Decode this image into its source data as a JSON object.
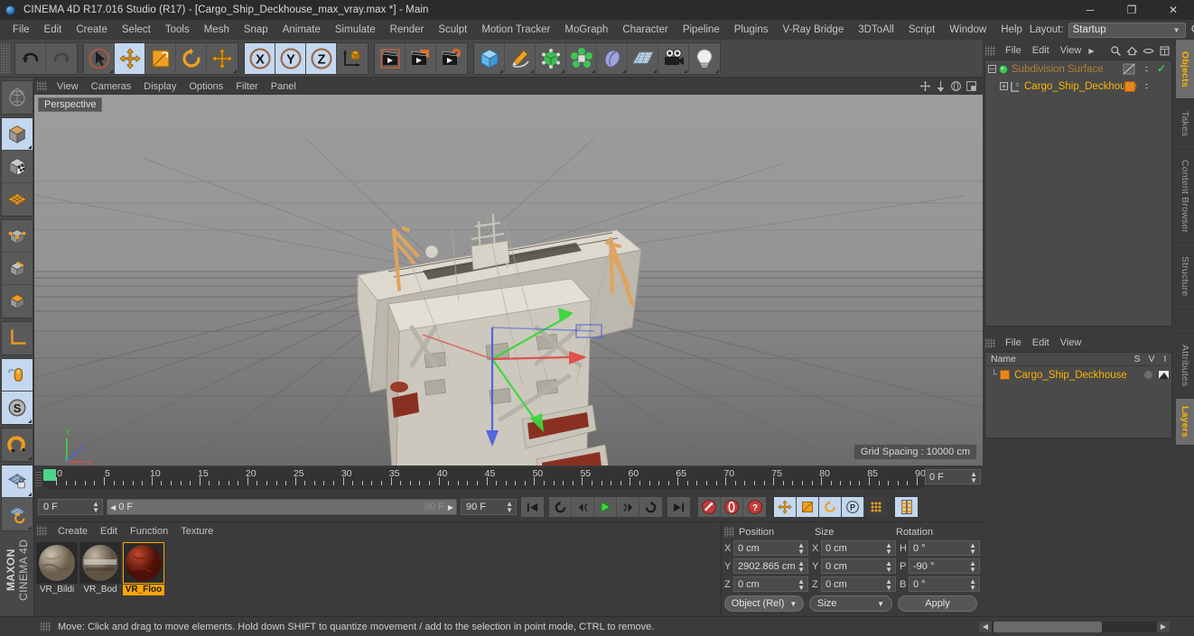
{
  "titlebar": {
    "title": "CINEMA 4D R17.016 Studio (R17) - [Cargo_Ship_Deckhouse_max_vray.max *] - Main",
    "minimize": "─",
    "maximize": "❐",
    "close": "✕"
  },
  "menubar": {
    "items": [
      "File",
      "Edit",
      "Create",
      "Select",
      "Tools",
      "Mesh",
      "Snap",
      "Animate",
      "Simulate",
      "Render",
      "Sculpt",
      "Motion Tracker",
      "MoGraph",
      "Character",
      "Pipeline",
      "Plugins",
      "V-Ray Bridge",
      "3DToAll",
      "Script",
      "Window",
      "Help"
    ],
    "layout_label": "Layout:",
    "layout_value": "Startup",
    "caret": "▼"
  },
  "toolbar": {
    "groups": [
      {
        "name": "undo-redo",
        "buttons": [
          {
            "icon": "undo-icon",
            "label": "Undo",
            "selected": false
          },
          {
            "icon": "redo-icon",
            "label": "Redo",
            "selected": false
          }
        ]
      },
      {
        "name": "transform-tools",
        "buttons": [
          {
            "icon": "live-selection-icon",
            "label": "Live Selection",
            "selected": false
          },
          {
            "icon": "move-icon",
            "label": "Move",
            "selected": true
          },
          {
            "icon": "scale-icon",
            "label": "Scale",
            "selected": false
          },
          {
            "icon": "rotate-icon",
            "label": "Rotate",
            "selected": false
          },
          {
            "icon": "move-alt-icon",
            "label": "Move (alt)",
            "selected": false
          }
        ]
      },
      {
        "name": "axis-locks",
        "buttons": [
          {
            "icon": "axis-x-icon",
            "label": "X",
            "selected": true
          },
          {
            "icon": "axis-y-icon",
            "label": "Y",
            "selected": true
          },
          {
            "icon": "axis-z-icon",
            "label": "Z",
            "selected": true
          },
          {
            "icon": "world-object-axis-icon",
            "label": "World / Object",
            "selected": false
          }
        ]
      },
      {
        "name": "render-tools",
        "buttons": [
          {
            "icon": "render-view-icon",
            "label": "Render View",
            "selected": false
          },
          {
            "icon": "render-picture-viewer-icon",
            "label": "Render to Picture Viewer",
            "selected": false
          },
          {
            "icon": "render-settings-icon",
            "label": "Edit Render Settings",
            "selected": false
          }
        ]
      },
      {
        "name": "object-tools",
        "buttons": [
          {
            "icon": "cube-primitive-icon",
            "label": "Add Cube Object",
            "selected": false
          },
          {
            "icon": "spline-pen-icon",
            "label": "Spline Pen",
            "selected": false
          },
          {
            "icon": "nurbs-icon",
            "label": "NURBS",
            "selected": false
          },
          {
            "icon": "array-modeling-icon",
            "label": "Modeling Objects",
            "selected": false
          },
          {
            "icon": "deformer-icon",
            "label": "Deformers",
            "selected": false
          },
          {
            "icon": "floor-environment-icon",
            "label": "Scene / Floor",
            "selected": false
          },
          {
            "icon": "camera-icon",
            "label": "Camera",
            "selected": false
          },
          {
            "icon": "light-icon",
            "label": "Light",
            "selected": false
          }
        ]
      }
    ]
  },
  "lefttoolbar": {
    "buttons": [
      {
        "icon": "make-editable-icon",
        "label": "Make Editable",
        "selected": false
      },
      {
        "icon": "model-mode-icon",
        "label": "Model Mode",
        "selected": true
      },
      {
        "icon": "texture-mode-icon",
        "label": "Texture Mode",
        "selected": false
      },
      {
        "icon": "polygon-mode-icon",
        "label": "Polygon Mode",
        "selected": false
      },
      {
        "icon": "point-mode-icon",
        "label": "Point Mode",
        "selected": false
      },
      {
        "icon": "edge-mode-icon",
        "label": "Edge Mode",
        "selected": false
      },
      {
        "icon": "object-axis-icon",
        "label": "Enable Axis",
        "selected": false
      },
      {
        "icon": "world-axis-icon",
        "label": "World Coordinates",
        "selected": false
      },
      {
        "icon": "viewport-solo-icon",
        "label": "Viewport Solo Single",
        "selected": true
      },
      {
        "icon": "soft-selection-icon",
        "label": "Soft Selection",
        "selected": true
      },
      {
        "icon": "magnet-icon",
        "label": "Magnet",
        "selected": false
      },
      {
        "icon": "workplane-lock-icon",
        "label": "Lock Workplane",
        "selected": true
      },
      {
        "icon": "workplane-rotate-icon",
        "label": "Rotate Workplane",
        "selected": false
      }
    ],
    "brand_line1": "MAXON",
    "brand_line2": "CINEMA 4D"
  },
  "viewport": {
    "menu": [
      "View",
      "Cameras",
      "Display",
      "Options",
      "Filter",
      "Panel"
    ],
    "corner_icons": [
      "pan-icon",
      "dolly-icon",
      "orbit-icon",
      "maximize-viewport-icon"
    ],
    "perspective_label": "Perspective",
    "grid_spacing": "Grid Spacing : 10000 cm",
    "axis_labels": {
      "x": "X",
      "y": "Y",
      "z": "Z"
    }
  },
  "timeline": {
    "ticks": [
      0,
      5,
      10,
      15,
      20,
      25,
      30,
      35,
      40,
      45,
      50,
      55,
      60,
      65,
      70,
      75,
      80,
      85,
      90
    ],
    "current_frame_field": "0 F",
    "spinner": "↕"
  },
  "transport": {
    "current_frame": "0 F",
    "scrub_start": "0 F",
    "scrub_end": "90 F",
    "scrub_left_arrow": "◀",
    "scrub_right_arrow": "▶",
    "end_frame": "90 F",
    "buttons": [
      {
        "icon": "go-to-start-icon",
        "label": "Go to Start",
        "group": 1,
        "state": "normal"
      },
      {
        "icon": "play-backwards-icon",
        "label": "Play Backwards",
        "group": 2,
        "state": "normal"
      },
      {
        "icon": "previous-frame-icon",
        "label": "Previous Frame",
        "group": 2,
        "state": "normal"
      },
      {
        "icon": "play-forward-icon",
        "label": "Play Forward",
        "group": 2,
        "state": "normal"
      },
      {
        "icon": "next-frame-icon",
        "label": "Next Frame",
        "group": 2,
        "state": "normal"
      },
      {
        "icon": "loop-icon",
        "label": "Play Mode Loop",
        "group": 2,
        "state": "normal"
      },
      {
        "icon": "go-to-end-icon",
        "label": "Go to End",
        "group": 3,
        "state": "normal"
      },
      {
        "icon": "record-active-objects-icon",
        "label": "Record Active Objects",
        "group": 4,
        "state": "normal"
      },
      {
        "icon": "autokeying-icon",
        "label": "Autokeying",
        "group": 4,
        "state": "normal"
      },
      {
        "icon": "keyframe-selection-icon",
        "label": "Keyframe Selection",
        "group": 4,
        "state": "normal"
      },
      {
        "icon": "position-key-icon",
        "label": "Position Key",
        "group": 5,
        "state": "selected"
      },
      {
        "icon": "scale-key-icon",
        "label": "Scale Key",
        "group": 5,
        "state": "selected"
      },
      {
        "icon": "rotation-key-icon",
        "label": "Rotation Key",
        "group": 5,
        "state": "selected"
      },
      {
        "icon": "parameter-key-icon",
        "label": "Parameter Key",
        "group": 5,
        "state": "selected"
      },
      {
        "icon": "point-level-animation-icon",
        "label": "Point Level Animation",
        "group": 5,
        "state": "dark"
      },
      {
        "icon": "timeline-editor-icon",
        "label": "Timeline / Dope Sheet",
        "group": 6,
        "state": "selected"
      }
    ]
  },
  "materialmanager": {
    "menu": [
      "Create",
      "Edit",
      "Function",
      "Texture"
    ],
    "materials": [
      {
        "name": "VR_Bildi",
        "selected": false,
        "color": "#9a8a76"
      },
      {
        "name": "VR_Bod",
        "selected": false,
        "color": "#8c7a66"
      },
      {
        "name": "VR_Floo",
        "selected": true,
        "color": "#8e2016"
      }
    ]
  },
  "coordinates": {
    "headers": [
      "Position",
      "Size",
      "Rotation"
    ],
    "rows": [
      {
        "axis1": "X",
        "pos": "0 cm",
        "axis2": "X",
        "size": "0 cm",
        "axis3": "H",
        "rot": "0 °"
      },
      {
        "axis1": "Y",
        "pos": "2902.865 cm",
        "axis2": "Y",
        "size": "0 cm",
        "axis3": "P",
        "rot": "-90 °"
      },
      {
        "axis1": "Z",
        "pos": "0 cm",
        "axis2": "Z",
        "size": "0 cm",
        "axis3": "B",
        "rot": "0 °"
      }
    ],
    "mode_dropdown": "Object (Rel)",
    "size_dropdown": "Size",
    "apply_button": "Apply",
    "caret": "▼",
    "spinner": "↕"
  },
  "objectmanager": {
    "menu": [
      "File",
      "Edit",
      "View"
    ],
    "menu_more": "▶",
    "icons": [
      "search-icon",
      "home-icon",
      "eye-icon",
      "fit-icon"
    ],
    "rows": [
      {
        "name": "Subdivision Surface",
        "level": 0,
        "color": "dim",
        "icon": "subdivision-surface-icon",
        "tag_checked": true
      },
      {
        "name": "Cargo_Ship_Deckhouse",
        "level": 1,
        "color": "hl",
        "icon": "polygon-object-icon",
        "tag_checked": false
      }
    ]
  },
  "attributespanel": {
    "menu": [
      "File",
      "Edit",
      "View"
    ],
    "columns": [
      "Name",
      "S",
      "V",
      "I"
    ],
    "rows": [
      {
        "name": "Cargo_Ship_Deckhouse",
        "swatch": "#e8861e"
      }
    ]
  },
  "verticaltabs": [
    {
      "label": "Objects",
      "active": true
    },
    {
      "label": "Takes",
      "active": false
    },
    {
      "label": "Content Browser",
      "active": false
    },
    {
      "label": "Structure",
      "active": false
    },
    {
      "label": "Attributes",
      "active": false
    },
    {
      "label": "Layers",
      "active": true
    }
  ],
  "statusbar": {
    "text": "Move: Click and drag to move elements. Hold down SHIFT to quantize movement / add to the selection in point mode, CTRL to remove.",
    "left_arrow": "◀",
    "right_arrow": "▶"
  },
  "colors": {
    "accent_orange": "#ffb400",
    "selection_blue": "#c3d7ef",
    "axis_x": "#d84040",
    "axis_y": "#4ad84a",
    "axis_z": "#4060d8",
    "panel_bg": "#3b3b3b",
    "field_bg": "#4a4a4a"
  }
}
